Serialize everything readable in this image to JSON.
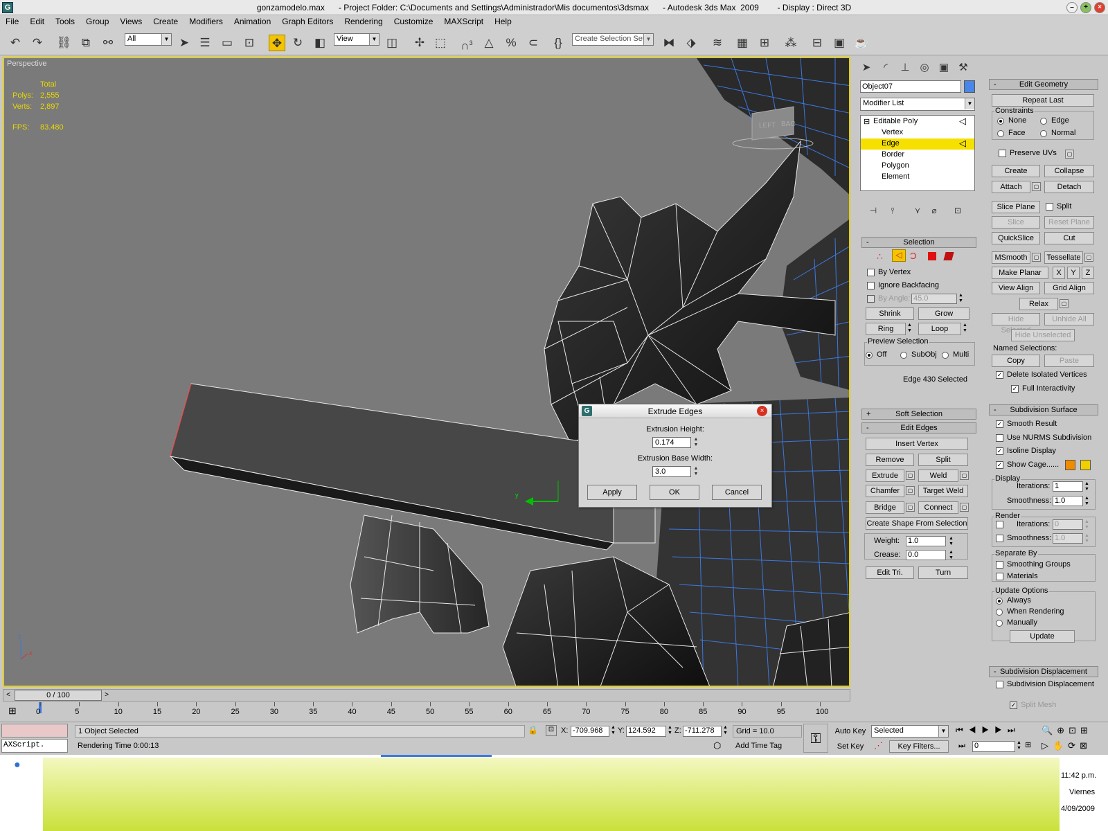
{
  "window": {
    "title": "gonzamodelo.max      - Project Folder: C:\\Documents and Settings\\Administrador\\Mis documentos\\3dsmax      - Autodesk 3ds Max  2009        - Display : Direct 3D",
    "app_icon": "G"
  },
  "menu": [
    "File",
    "Edit",
    "Tools",
    "Group",
    "Views",
    "Create",
    "Modifiers",
    "Animation",
    "Graph Editors",
    "Rendering",
    "Customize",
    "MAXScript",
    "Help"
  ],
  "toolbar": {
    "filter": "All",
    "coord_system": "View",
    "selection_set_placeholder": "Create Selection Set",
    "snap_label": "3"
  },
  "viewport": {
    "label": "Perspective",
    "stats_header": "Total",
    "polys_label": "Polys:",
    "polys": "2,555",
    "verts_label": "Verts:",
    "verts": "2,897",
    "fps_label": "FPS:",
    "fps": "83.480",
    "viewcube_left": "LEFT",
    "viewcube_right": "BAC",
    "axis_z": "z",
    "axis_x": "x",
    "gizmo_y": "y"
  },
  "dialog": {
    "title": "Extrude Edges",
    "height_label": "Extrusion Height:",
    "height_value": "0.174",
    "width_label": "Extrusion Base Width:",
    "width_value": "3.0",
    "apply": "Apply",
    "ok": "OK",
    "cancel": "Cancel"
  },
  "command_panel": {
    "object_name": "Object07",
    "object_color": "#4a86e8",
    "modifier_list": "Modifier List",
    "stack": [
      "Editable Poly",
      "Vertex",
      "Edge",
      "Border",
      "Polygon",
      "Element"
    ],
    "selection": {
      "title": "Selection",
      "by_vertex": "By Vertex",
      "ignore_backfacing": "Ignore Backfacing",
      "by_angle": "By Angle:",
      "angle_value": "45.0",
      "shrink": "Shrink",
      "grow": "Grow",
      "ring": "Ring",
      "loop": "Loop",
      "preview_title": "Preview Selection",
      "off": "Off",
      "subobj": "SubObj",
      "multi": "Multi",
      "status": "Edge 430 Selected"
    },
    "soft_selection": "Soft Selection",
    "edit_edges": {
      "title": "Edit Edges",
      "insert_vertex": "Insert Vertex",
      "remove": "Remove",
      "split": "Split",
      "extrude": "Extrude",
      "weld": "Weld",
      "chamfer": "Chamfer",
      "target_weld": "Target Weld",
      "bridge": "Bridge",
      "connect": "Connect",
      "create_shape": "Create Shape From Selection",
      "weight_label": "Weight:",
      "weight": "1.0",
      "crease_label": "Crease:",
      "crease": "0.0",
      "edit_tri": "Edit Tri.",
      "turn": "Turn"
    },
    "edit_geometry": {
      "title": "Edit Geometry",
      "repeat_last": "Repeat Last",
      "constraints": "Constraints",
      "none": "None",
      "edge": "Edge",
      "face": "Face",
      "normal": "Normal",
      "preserve_uvs": "Preserve UVs",
      "create": "Create",
      "collapse": "Collapse",
      "attach": "Attach",
      "detach": "Detach",
      "slice_plane": "Slice Plane",
      "split": "Split",
      "slice": "Slice",
      "reset_plane": "Reset Plane",
      "quickslice": "QuickSlice",
      "cut": "Cut",
      "msmooth": "MSmooth",
      "tessellate": "Tessellate",
      "make_planar": "Make Planar",
      "x": "X",
      "y": "Y",
      "z": "Z",
      "view_align": "View Align",
      "grid_align": "Grid Align",
      "relax": "Relax",
      "hide_selected": "Hide Selected",
      "unhide_all": "Unhide All",
      "hide_unselected": "Hide Unselected",
      "named_selections": "Named Selections:",
      "copy": "Copy",
      "paste": "Paste",
      "delete_isolated": "Delete Isolated Vertices",
      "full_interactivity": "Full Interactivity"
    },
    "subdivision_surface": {
      "title": "Subdivision Surface",
      "smooth_result": "Smooth Result",
      "use_nurms": "Use NURMS Subdivision",
      "isoline": "Isoline Display",
      "show_cage": "Show Cage......",
      "cage_color_1": "#f08c00",
      "cage_color_2": "#f0d000",
      "display": "Display",
      "iterations_label": "Iterations:",
      "iterations": "1",
      "smoothness_label": "Smoothness:",
      "smoothness": "1.0",
      "render": "Render",
      "render_iterations": "0",
      "render_smoothness": "1.0",
      "separate_by": "Separate By",
      "smoothing_groups": "Smoothing Groups",
      "materials": "Materials",
      "update_options": "Update Options",
      "always": "Always",
      "when_rendering": "When Rendering",
      "manually": "Manually",
      "update": "Update"
    },
    "subdivision_displacement": {
      "title": "Subdivision Displacement",
      "checkbox": "Subdivision Displacement",
      "split_mesh": "Split Mesh"
    }
  },
  "timeline": {
    "frame": "0 / 100",
    "ticks": [
      "0",
      "5",
      "10",
      "15",
      "20",
      "25",
      "30",
      "35",
      "40",
      "45",
      "50",
      "55",
      "60",
      "65",
      "70",
      "75",
      "80",
      "85",
      "90",
      "95",
      "100"
    ]
  },
  "status": {
    "maxscript": "AXScript.",
    "selected": "1 Object Selected",
    "render_time": "Rendering Time  0:00:13",
    "x_label": "X:",
    "x": "-709.968",
    "y_label": "Y:",
    "y": "124.592",
    "z_label": "Z:",
    "z": "-711.278",
    "grid": "Grid = 10.0",
    "add_time_tag": "Add Time Tag",
    "auto_key": "Auto Key",
    "set_key": "Set Key",
    "key_mode": "Selected",
    "key_filters": "Key Filters...",
    "current_frame": "0"
  },
  "taskbar": {
    "time": "11:42 p.m.",
    "day": "Viernes",
    "date": "4/09/2009"
  }
}
